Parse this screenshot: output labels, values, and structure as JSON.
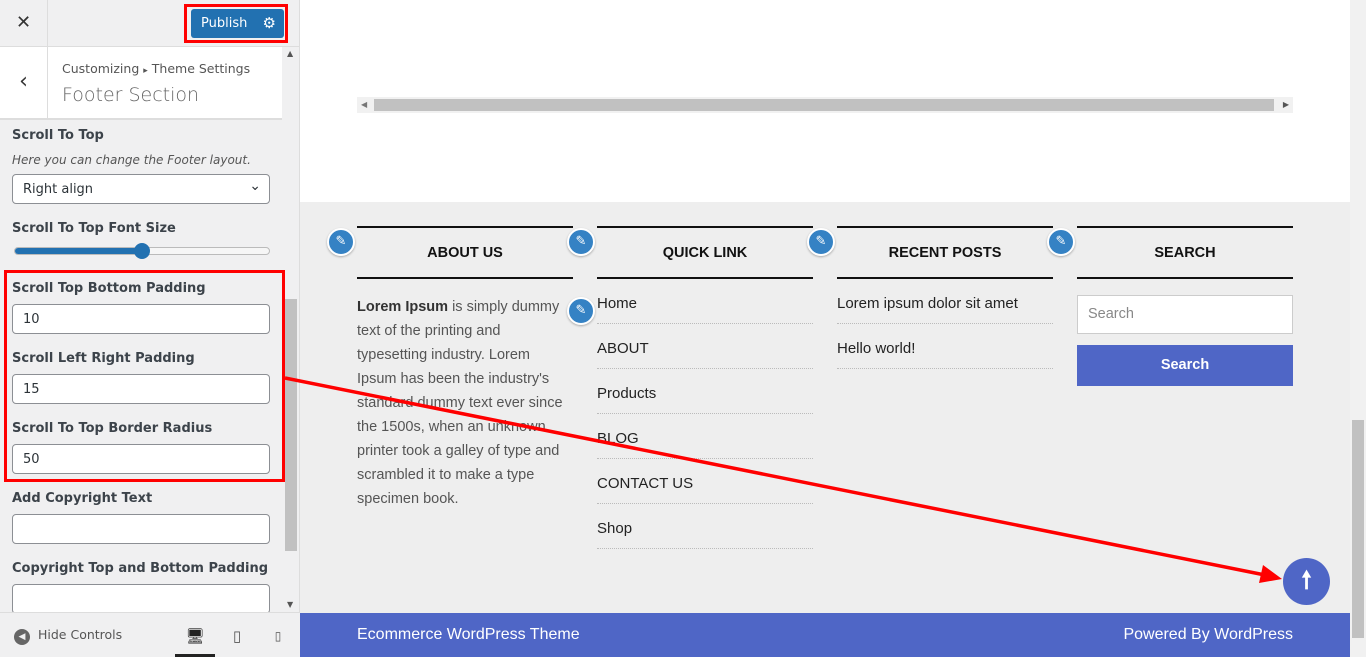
{
  "topbar": {
    "close_icon": "close-icon",
    "publish_label": "Publish",
    "gear_icon": "gear-icon"
  },
  "header": {
    "back_icon": "chevron-left-icon",
    "breadcrumb_root": "Customizing",
    "breadcrumb_sep": "▸",
    "breadcrumb_parent": "Theme Settings",
    "title": "Footer Section"
  },
  "controls": {
    "scroll_to_top": {
      "label": "Scroll To Top",
      "description": "Here you can change the Footer layout.",
      "value": "Right align"
    },
    "font_size": {
      "label": "Scroll To Top Font Size",
      "slider_percent": 50
    },
    "bottom_padding": {
      "label": "Scroll Top Bottom Padding",
      "value": "10"
    },
    "lr_padding": {
      "label": "Scroll Left Right Padding",
      "value": "15"
    },
    "border_radius": {
      "label": "Scroll To Top Border Radius",
      "value": "50"
    },
    "copyright": {
      "label": "Add Copyright Text",
      "value": ""
    },
    "copyright_padding": {
      "label": "Copyright Top and Bottom Padding",
      "value": ""
    }
  },
  "footer_bar": {
    "hide_controls": "Hide Controls"
  },
  "preview": {
    "about": {
      "title": "ABOUT US",
      "bold": "Lorem Ipsum",
      "text": " is simply dummy text of the printing and typesetting industry. Lorem Ipsum has been the industry's standard dummy text ever since the 1500s, when an unknown printer took a galley of type and scrambled it to make a type specimen book."
    },
    "quick": {
      "title": "QUICK LINK",
      "items": [
        "Home",
        "ABOUT",
        "Products",
        "BLOG",
        "CONTACT US",
        "Shop"
      ]
    },
    "recent": {
      "title": "RECENT POSTS",
      "items": [
        "Lorem ipsum dolor sit amet",
        "Hello world!"
      ]
    },
    "search": {
      "title": "SEARCH",
      "placeholder": "Search",
      "button": "Search"
    },
    "bottom_left": "Ecommerce WordPress Theme",
    "bottom_right": "Powered By WordPress"
  },
  "colors": {
    "accent": "#4f66c6",
    "publish": "#2271b1",
    "annotation": "#ff0000"
  }
}
